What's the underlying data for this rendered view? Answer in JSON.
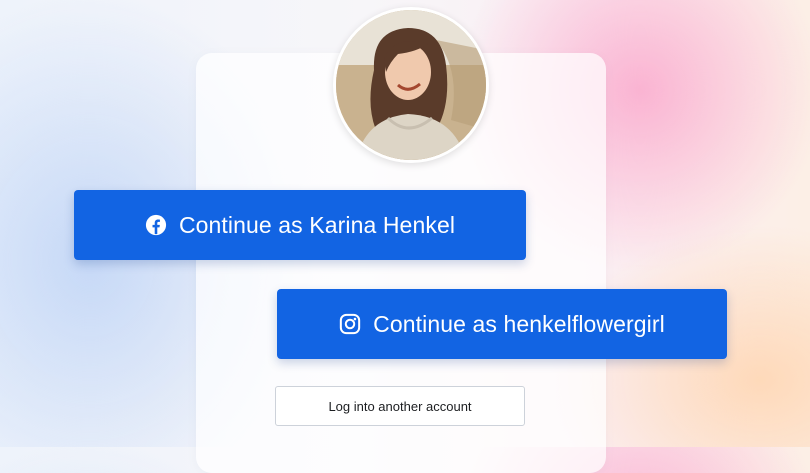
{
  "profile": {
    "avatar_alt": "Karina Henkel profile photo"
  },
  "buttons": {
    "facebook_label": "Continue as Karina Henkel",
    "instagram_label": "Continue as henkelflowergirl",
    "other_account_label": "Log into another account"
  },
  "icons": {
    "facebook": "facebook-icon",
    "instagram": "instagram-icon"
  },
  "colors": {
    "primary": "#1264e3",
    "primary_text": "#ffffff",
    "secondary_border": "#cdd2da"
  }
}
